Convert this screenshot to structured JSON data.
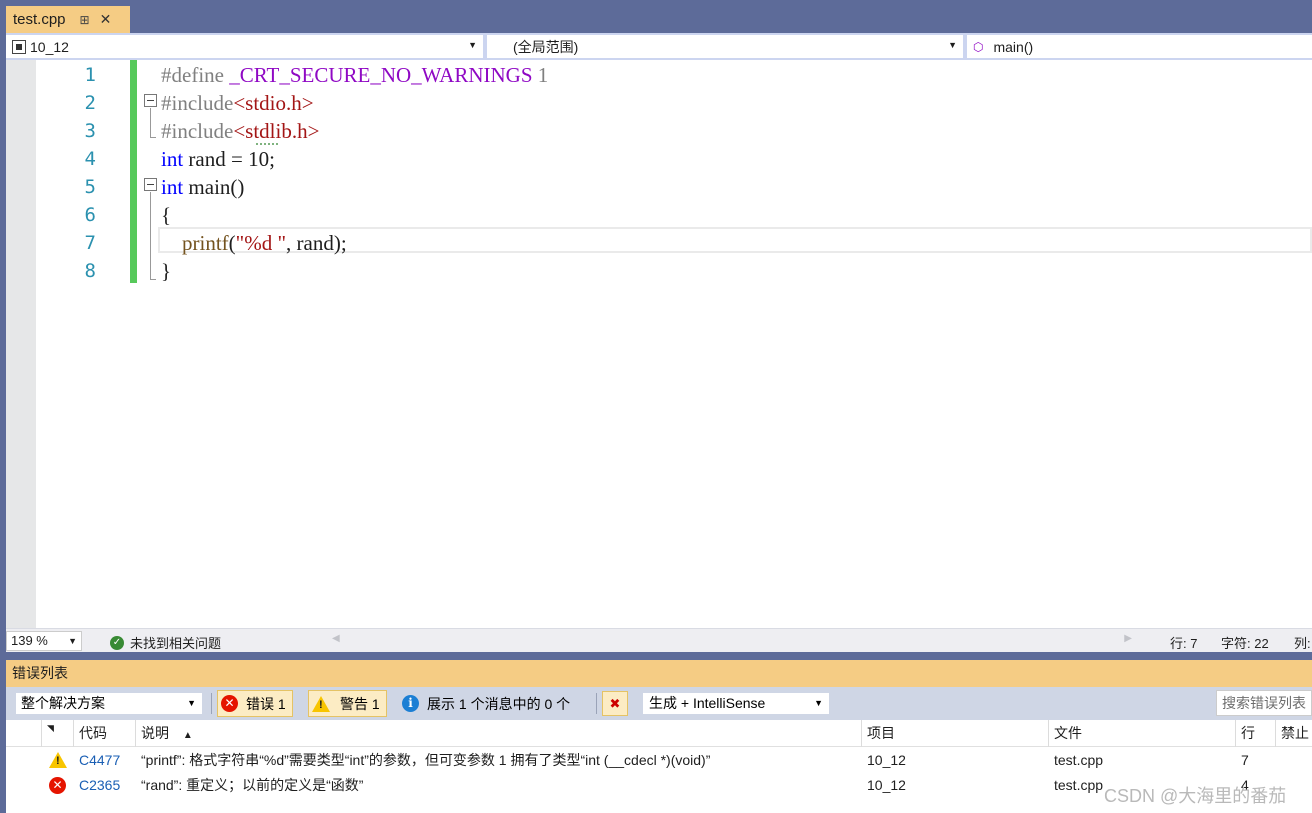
{
  "tab": {
    "label": "test.cpp",
    "pin_icon": "pin-icon",
    "close_icon": "close-icon"
  },
  "navbar": {
    "project": "10_12",
    "scope": "(全局范围)",
    "member": "main()"
  },
  "editor": {
    "line_numbers": [
      "1",
      "2",
      "3",
      "4",
      "5",
      "6",
      "7",
      "8"
    ],
    "lines": [
      [
        [
          "pp",
          "#define "
        ],
        [
          "mac",
          "_CRT_SECURE_NO_WARNINGS"
        ],
        [
          "pp",
          " 1"
        ]
      ],
      [
        [
          "pp",
          "#include"
        ],
        [
          "str",
          "<stdio.h>"
        ]
      ],
      [
        [
          "pp",
          "#include"
        ],
        [
          "str",
          "<stdlib.h>"
        ]
      ],
      [
        [
          "kw",
          "int"
        ],
        [
          "",
          " rand = 10;"
        ]
      ],
      [
        [
          "kw",
          "int"
        ],
        [
          "",
          " main()"
        ]
      ],
      [
        [
          "",
          "{"
        ]
      ],
      [
        [
          "",
          "    "
        ],
        [
          "fn",
          "printf"
        ],
        [
          "",
          "("
        ],
        [
          "str",
          "\"%d \""
        ],
        [
          "",
          ", rand);"
        ]
      ],
      [
        [
          "",
          "}"
        ]
      ]
    ]
  },
  "editor_status": {
    "zoom": "139 %",
    "issues": "未找到相关问题",
    "line": "行: 7",
    "char": "字符: 22",
    "col": "列:"
  },
  "error_list": {
    "title": "错误列表",
    "scope": "整个解决方案",
    "errors_btn": "错误 1",
    "warnings_btn": "警告 1",
    "messages_btn": "展示 1 个消息中的 0 个",
    "build_filter": "生成 + IntelliSense",
    "search_placeholder": "搜索错误列表",
    "columns": {
      "code": "代码",
      "desc": "说明",
      "project": "项目",
      "file": "文件",
      "line": "行",
      "suppress": "禁止"
    },
    "rows": [
      {
        "severity": "warning",
        "code": "C4477",
        "desc": "“printf”: 格式字符串“%d”需要类型“int”的参数，但可变参数 1 拥有了类型“int (__cdecl *)(void)”",
        "project": "10_12",
        "file": "test.cpp",
        "line": "7"
      },
      {
        "severity": "error",
        "code": "C2365",
        "desc": "“rand”: 重定义；以前的定义是“函数”",
        "project": "10_12",
        "file": "test.cpp",
        "line": "4"
      }
    ]
  },
  "watermark": "CSDN @大海里的番茄"
}
